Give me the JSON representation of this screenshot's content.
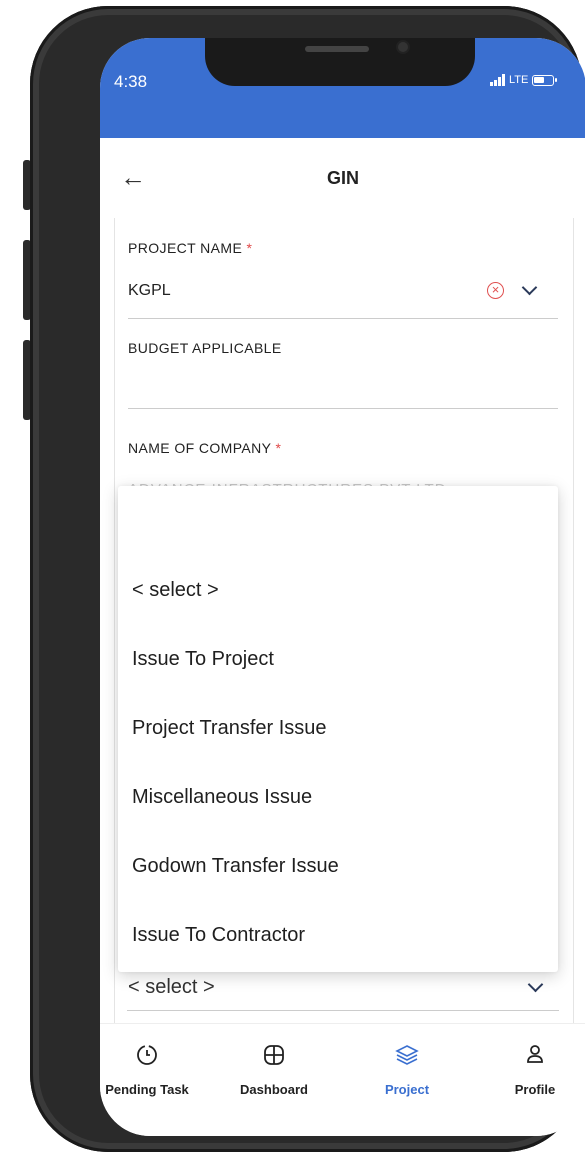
{
  "status_bar": {
    "time": "4:38",
    "network": "LTE"
  },
  "header": {
    "title": "GIN"
  },
  "form": {
    "project_name": {
      "label": "PROJECT NAME",
      "required_mark": "*",
      "value": "KGPL"
    },
    "budget_applicable": {
      "label": "BUDGET APPLICABLE",
      "value": ""
    },
    "name_of_company": {
      "label": "NAME OF COMPANY",
      "required_mark": "*",
      "value": "ADVANCE INFRASTRUCTURES PVT LTD"
    }
  },
  "dropdown": {
    "options": [
      "< select >",
      "Issue To Project",
      "Project Transfer Issue",
      "Miscellaneous Issue",
      "Godown Transfer Issue",
      "Issue To Contractor"
    ]
  },
  "bottom_select": {
    "value": "< select >"
  },
  "nav": {
    "items": [
      {
        "label": "Pending Task",
        "icon": "clock-icon"
      },
      {
        "label": "Dashboard",
        "icon": "dashboard-icon"
      },
      {
        "label": "Project",
        "icon": "layers-icon"
      },
      {
        "label": "Profile",
        "icon": "user-icon"
      }
    ],
    "active_index": 2
  },
  "colors": {
    "primary": "#3a6fd0",
    "required": "#e04848",
    "clear_icon": "#e05050"
  }
}
